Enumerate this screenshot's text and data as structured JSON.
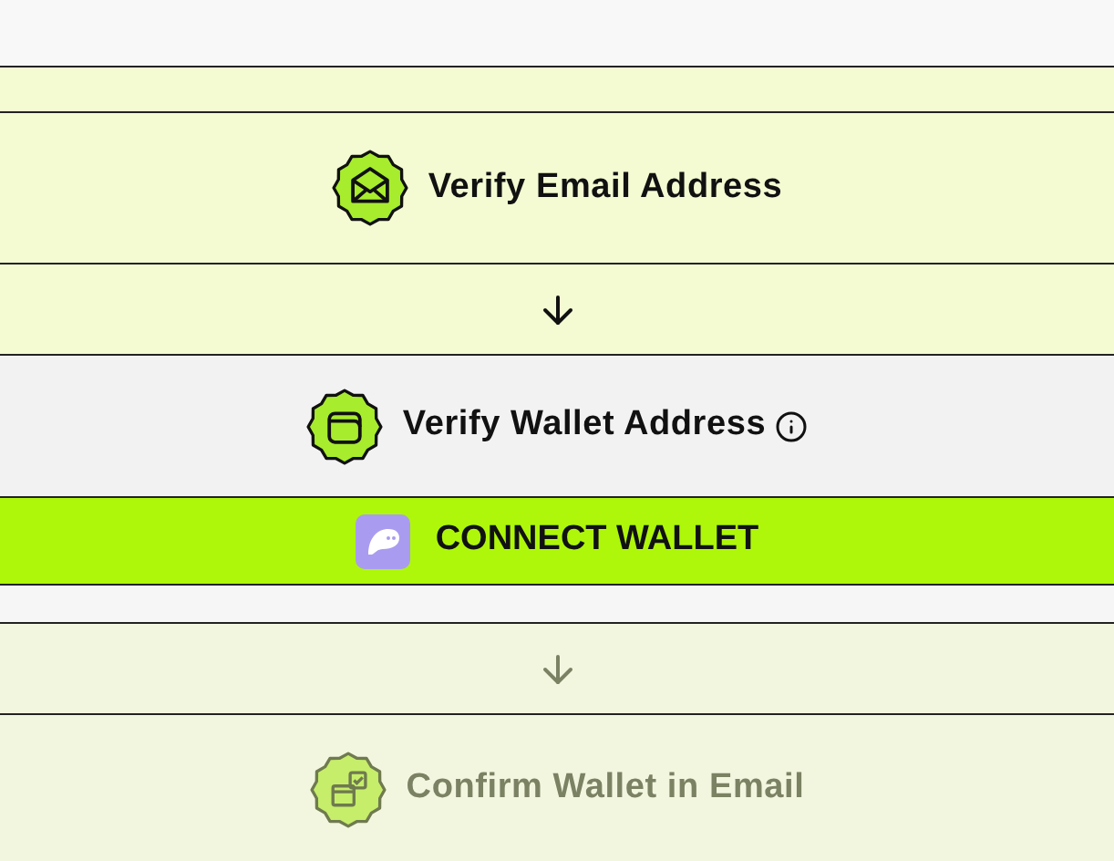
{
  "steps": [
    {
      "kind": "step",
      "label": "Verify Email Address",
      "completed": true,
      "disabled": false,
      "info": false
    },
    {
      "kind": "arrow",
      "disabled": false
    },
    {
      "kind": "step",
      "label": "Verify Wallet Address",
      "completed": false,
      "disabled": false,
      "info": true
    },
    {
      "kind": "button",
      "label": "CONNECT WALLET"
    },
    {
      "kind": "arrow",
      "disabled": true
    },
    {
      "kind": "step",
      "label": "Confirm Wallet in Email",
      "completed": false,
      "disabled": true,
      "info": false
    }
  ]
}
